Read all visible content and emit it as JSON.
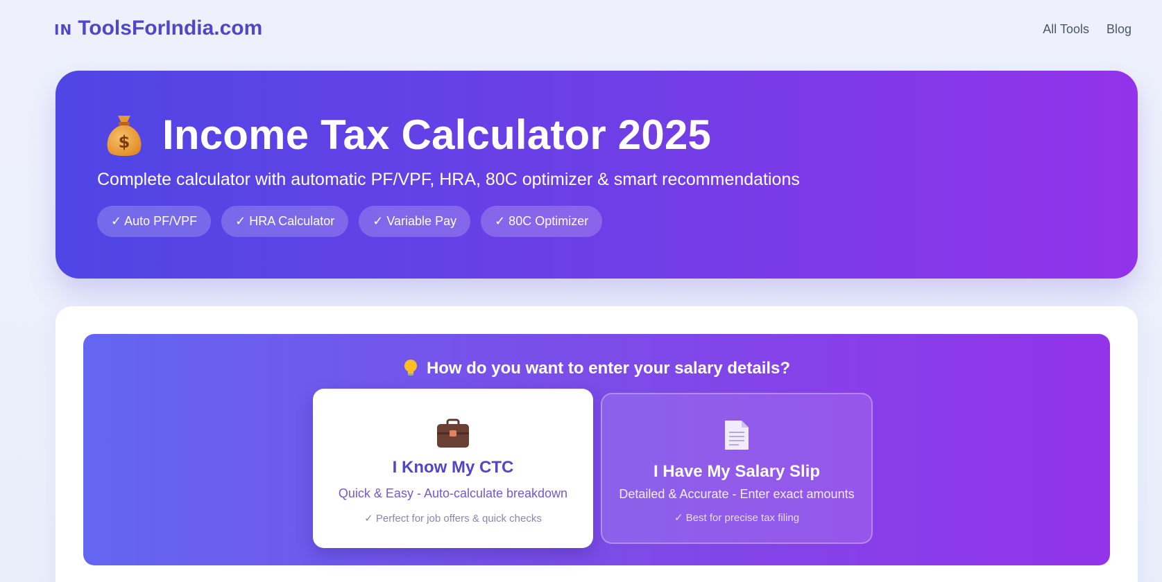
{
  "header": {
    "flag_code": "IN",
    "site_name": "ToolsForIndia.com",
    "nav": [
      "All Tools",
      "Blog"
    ]
  },
  "hero": {
    "icon": "money-bag-icon",
    "title": "Income Tax Calculator 2025",
    "subtitle": "Complete calculator with automatic PF/VPF, HRA, 80C optimizer & smart recommendations",
    "features": [
      "✓ Auto PF/VPF",
      "✓ HRA Calculator",
      "✓ Variable Pay",
      "✓ 80C Optimizer"
    ]
  },
  "entry_mode": {
    "icon": "lightbulb-icon",
    "question": "How do you want to enter your salary details?",
    "options": [
      {
        "icon": "briefcase-icon",
        "title": "I Know My CTC",
        "description": "Quick & Easy - Auto-calculate breakdown",
        "note": "✓ Perfect for job offers & quick checks",
        "selected": true
      },
      {
        "icon": "document-icon",
        "title": "I Have My Salary Slip",
        "description": "Detailed & Accurate - Enter exact amounts",
        "note": "✓ Best for precise tax filing",
        "selected": false
      }
    ]
  },
  "colors": {
    "brand": "#4f46c8",
    "hero_gradient_start": "#4f46e5",
    "hero_gradient_end": "#9333ea",
    "page_background": "#eef1fb"
  }
}
